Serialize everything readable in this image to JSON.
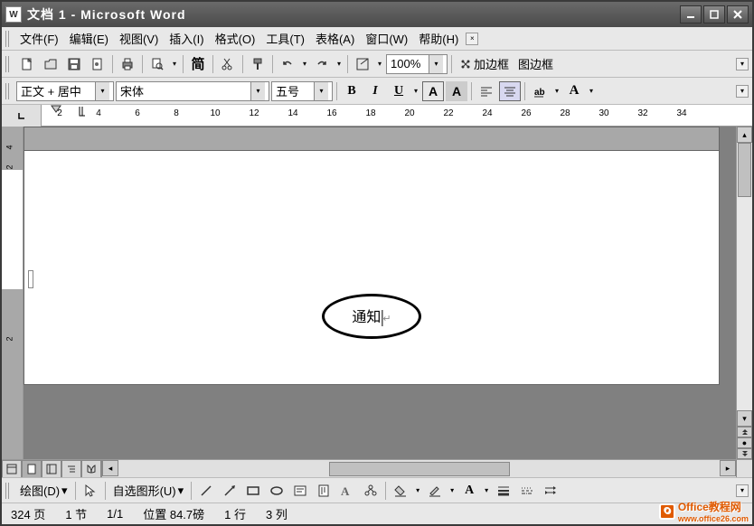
{
  "title": "文档 1 - Microsoft Word",
  "menu": {
    "file": "文件(F)",
    "edit": "编辑(E)",
    "view": "视图(V)",
    "insert": "插入(I)",
    "format": "格式(O)",
    "tools": "工具(T)",
    "table": "表格(A)",
    "window": "窗口(W)",
    "help": "帮助(H)"
  },
  "standard_toolbar": {
    "zoom_value": "100%",
    "jiabiankuang": "加边框",
    "tubiankuang": "图边框",
    "jian": "简"
  },
  "format_toolbar": {
    "style": "正文 + 居中",
    "font": "宋体",
    "size": "五号",
    "bold": "B",
    "italic": "I",
    "underline": "U",
    "a1": "A",
    "a2": "A",
    "a3": "A"
  },
  "ruler_ticks": [
    2,
    4,
    6,
    8,
    10,
    12,
    14,
    16,
    18,
    20,
    22,
    24,
    26,
    28,
    30,
    32,
    34
  ],
  "vruler_ticks_top": [
    "4",
    "2"
  ],
  "vruler_ticks_bottom": [
    "",
    "2"
  ],
  "document": {
    "text": "通知"
  },
  "draw_toolbar": {
    "draw_label": "绘图(D)",
    "autoshapes": "自选图形(U)"
  },
  "statusbar": {
    "page": "324 页",
    "section": "1 节",
    "pages": "1/1",
    "position": "位置  84.7磅",
    "line": "1 行",
    "column": "3 列"
  },
  "watermark": {
    "text1": "Office教程网",
    "text2": "www.office26.com"
  }
}
